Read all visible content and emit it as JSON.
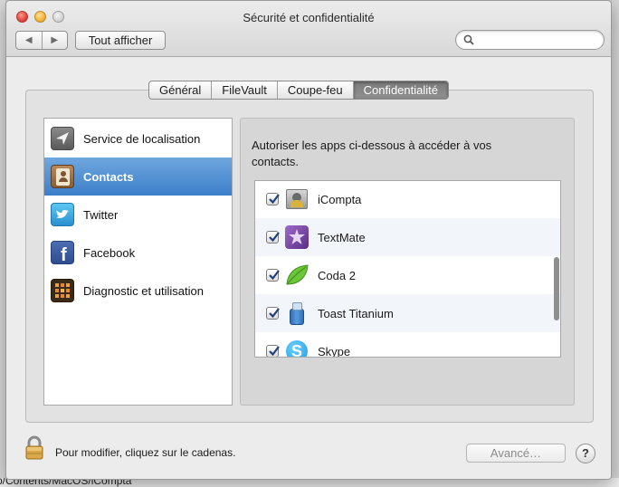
{
  "window": {
    "title": "Sécurité et confidentialité",
    "show_all_label": "Tout afficher",
    "back_glyph": "◀",
    "forward_glyph": "▶",
    "search": {
      "placeholder": "",
      "value": ""
    }
  },
  "tabs": [
    {
      "label": "Général",
      "active": false
    },
    {
      "label": "FileVault",
      "active": false
    },
    {
      "label": "Coupe-feu",
      "active": false
    },
    {
      "label": "Confidentialité",
      "active": true
    }
  ],
  "sidebar": {
    "items": [
      {
        "label": "Service de localisation",
        "icon": "location-arrow-icon",
        "selected": false
      },
      {
        "label": "Contacts",
        "icon": "contacts-book-icon",
        "selected": true
      },
      {
        "label": "Twitter",
        "icon": "twitter-bird-icon",
        "selected": false
      },
      {
        "label": "Facebook",
        "icon": "facebook-f-icon",
        "selected": false
      },
      {
        "label": "Diagnostic et utilisation",
        "icon": "diagnostic-grid-icon",
        "selected": false
      }
    ]
  },
  "main": {
    "description": "Autoriser les apps ci-dessous à accéder à vos contacts.",
    "apps": [
      {
        "name": "iCompta",
        "checked": true,
        "icon": "icompta-icon"
      },
      {
        "name": "TextMate",
        "checked": true,
        "icon": "textmate-icon"
      },
      {
        "name": "Coda 2",
        "checked": true,
        "icon": "coda-leaf-icon"
      },
      {
        "name": "Toast Titanium",
        "checked": true,
        "icon": "toast-titanium-icon"
      },
      {
        "name": "Skype",
        "checked": true,
        "icon": "skype-icon"
      }
    ]
  },
  "footer": {
    "lock_text": "Pour modifier, cliquez sur le cadenas.",
    "advanced_label": "Avancé…",
    "help_label": "?"
  },
  "background": {
    "path_text": "p/Contents/MacOS/iCompta"
  },
  "colors": {
    "selection": "#3c7fc9",
    "window_bg": "#ececec"
  }
}
